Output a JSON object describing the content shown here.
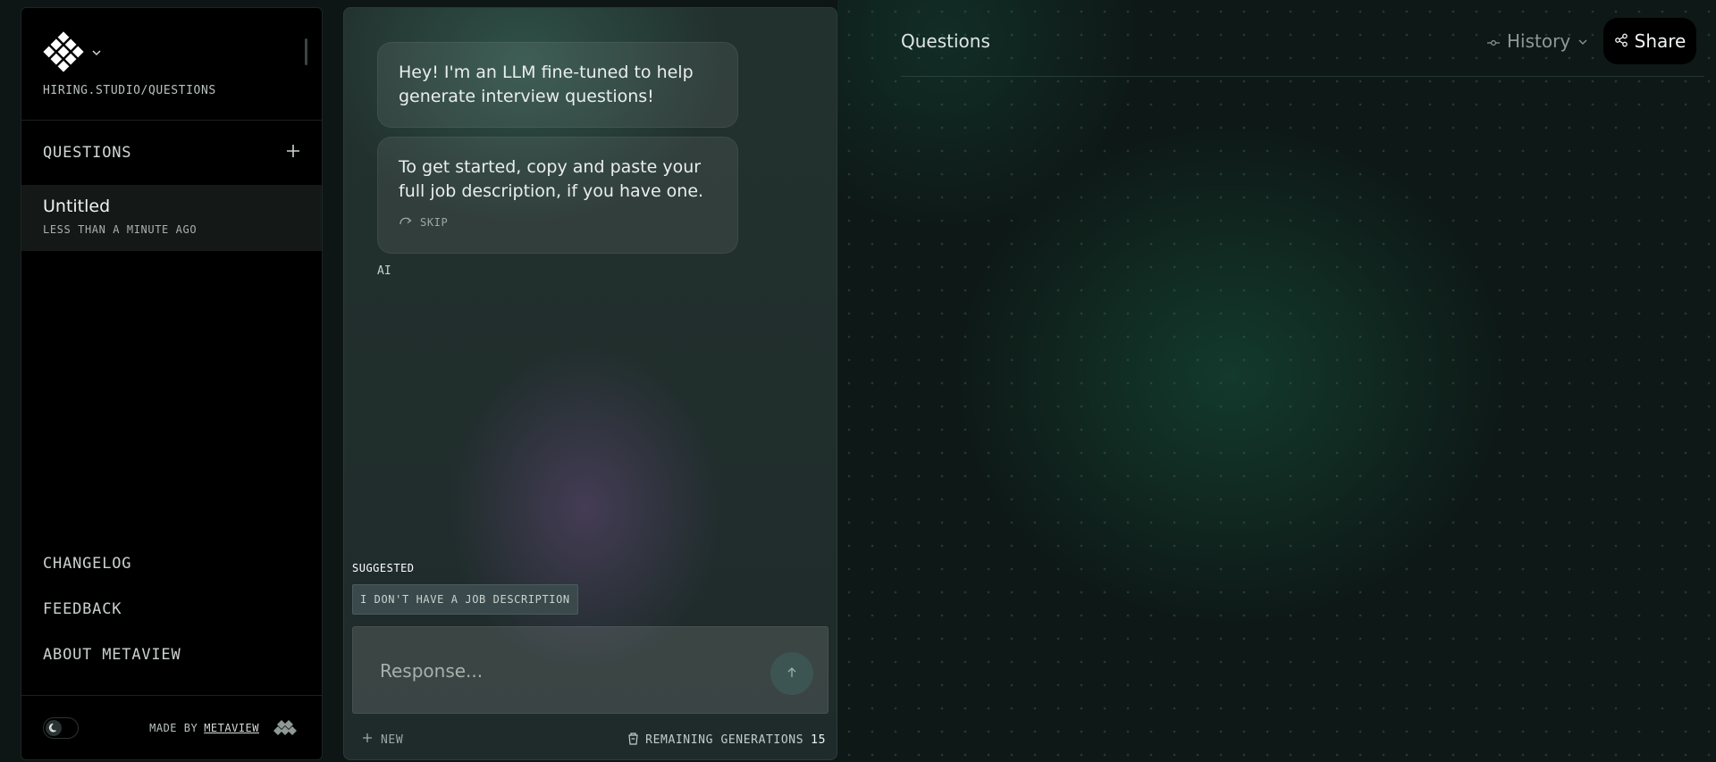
{
  "sidebar": {
    "breadcrumb": "HIRING.STUDIO/QUESTIONS",
    "section_title": "QUESTIONS",
    "items": [
      {
        "title": "Untitled",
        "time": "LESS THAN A MINUTE AGO"
      }
    ],
    "links": [
      "CHANGELOG",
      "FEEDBACK",
      "ABOUT METAVIEW"
    ],
    "made_by_label": "MADE BY",
    "made_by_link": "METAVIEW"
  },
  "chat": {
    "messages": [
      {
        "text": "Hey! I'm an LLM fine-tuned to help generate interview questions!"
      },
      {
        "text": "To get started, copy and paste your full job description, if you have one."
      }
    ],
    "skip_label": "SKIP",
    "sender_label": "AI",
    "suggested_label": "SUGGESTED",
    "suggestions": [
      "I DON'T HAVE A JOB DESCRIPTION"
    ],
    "input_placeholder": "Response...",
    "new_label": "NEW",
    "remaining_label": "REMAINING GENERATIONS",
    "remaining_count": "15"
  },
  "main": {
    "title": "Questions",
    "history_label": "History",
    "share_label": "Share"
  },
  "icons": {
    "logo": "diamond-grid-logo-icon",
    "chevron": "chevron-down-icon",
    "plus": "plus-icon",
    "theme": "moon-icon",
    "skip": "redo-arrow-icon",
    "send": "arrow-up-icon",
    "remaining": "cup-icon",
    "history": "commit-icon",
    "share": "share-icon"
  },
  "colors": {
    "page_bg": "#0d1614",
    "sidebar_bg": "#000000",
    "selected_item_bg": "#141918",
    "chat_bg": "#22312e",
    "send_button": "#3c5553",
    "suggestion_chip": "#3a4a4c"
  }
}
